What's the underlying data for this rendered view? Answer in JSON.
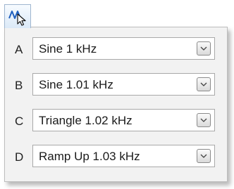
{
  "toolbar": {
    "tool_icon": "signal-generator-icon"
  },
  "channels": [
    {
      "letter": "A",
      "value": "Sine 1 kHz"
    },
    {
      "letter": "B",
      "value": "Sine 1.01 kHz"
    },
    {
      "letter": "C",
      "value": "Triangle 1.02 kHz"
    },
    {
      "letter": "D",
      "value": "Ramp Up 1.03 kHz"
    }
  ]
}
